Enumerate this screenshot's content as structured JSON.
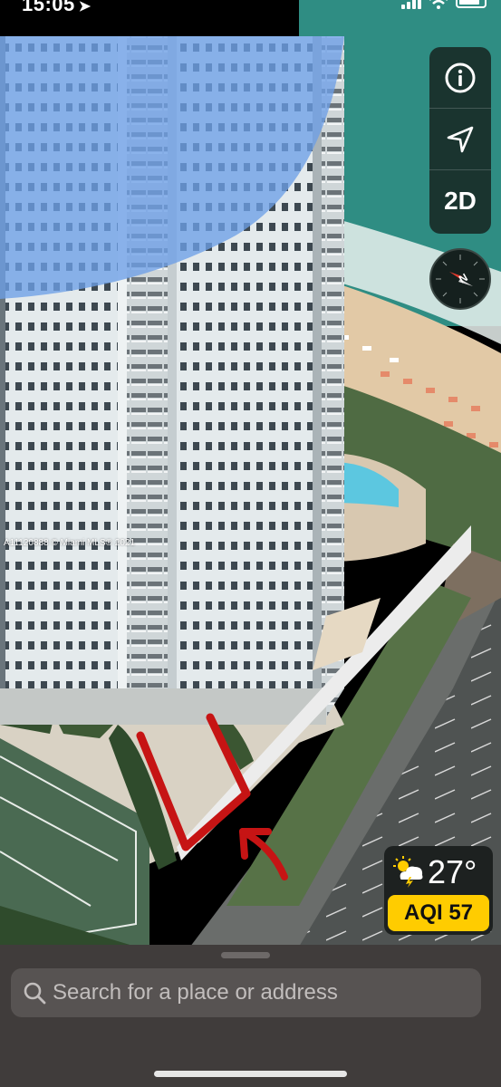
{
  "status_bar": {
    "time": "15:05",
    "location_arrow": "location-arrow-icon",
    "signal": "cellular-signal-icon",
    "wifi": "wifi-icon",
    "battery": "battery-icon"
  },
  "map_controls": {
    "info_icon": "info-icon",
    "location_icon": "location-arrow-icon",
    "view_toggle_label": "2D",
    "compass_icon": "compass-icon"
  },
  "map": {
    "watermark": "A11120888 © Miami MLS® 2021",
    "annotation_icon": "red-arrow-annotation",
    "colors": {
      "ocean": "#2f8d83",
      "sand": "#e2c9a6",
      "building": "#dfe6e8",
      "blue_overlay": "#6d9fe7",
      "annotation": "#c61414"
    }
  },
  "weather": {
    "icon": "thunderstorm-sun-icon",
    "temperature": "27°",
    "aqi_label": "AQI 57",
    "aqi_color": "#ffcc00"
  },
  "search": {
    "placeholder": "Search for a place or address",
    "icon": "search-icon"
  }
}
